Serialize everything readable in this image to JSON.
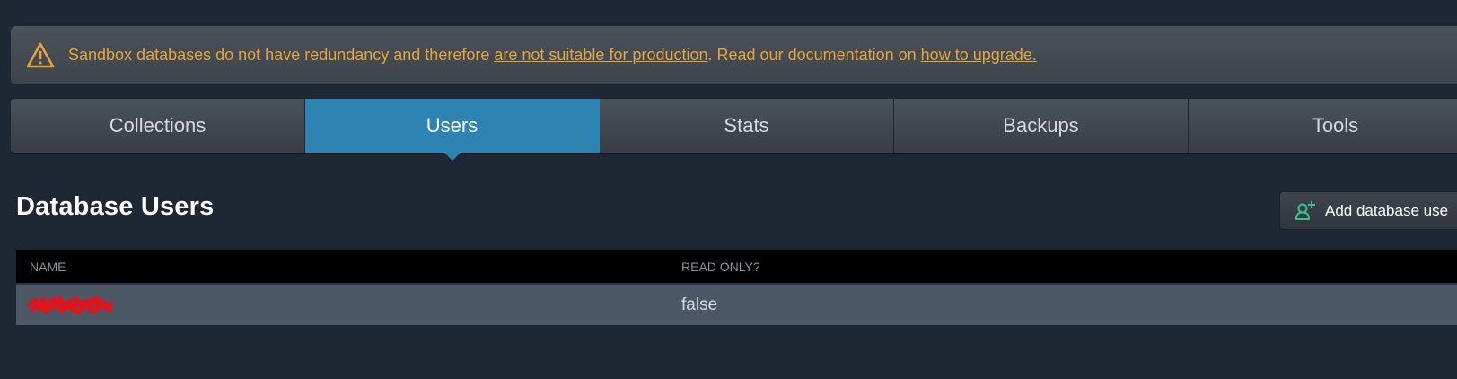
{
  "banner": {
    "text_before": "Sandbox databases do not have redundancy and therefore ",
    "link1": "are not suitable for production",
    "text_middle": ". Read our documentation on ",
    "link2": "how to upgrade.",
    "icon": "warning-icon",
    "color": "#e6a43a"
  },
  "tabs": [
    {
      "label": "Collections",
      "active": false
    },
    {
      "label": "Users",
      "active": true
    },
    {
      "label": "Stats",
      "active": false
    },
    {
      "label": "Backups",
      "active": false
    },
    {
      "label": "Tools",
      "active": false
    }
  ],
  "page": {
    "title": "Database Users"
  },
  "add_button": {
    "label": "Add database use",
    "icon": "add-user-icon"
  },
  "table": {
    "columns": [
      "NAME",
      "READ ONLY?"
    ],
    "rows": [
      {
        "name": "",
        "name_redacted": true,
        "read_only": "false"
      }
    ]
  },
  "colors": {
    "accent": "#2d84b3",
    "background": "#1e2734",
    "add_icon": "#3fbf8f",
    "redaction": "#e0141c"
  }
}
